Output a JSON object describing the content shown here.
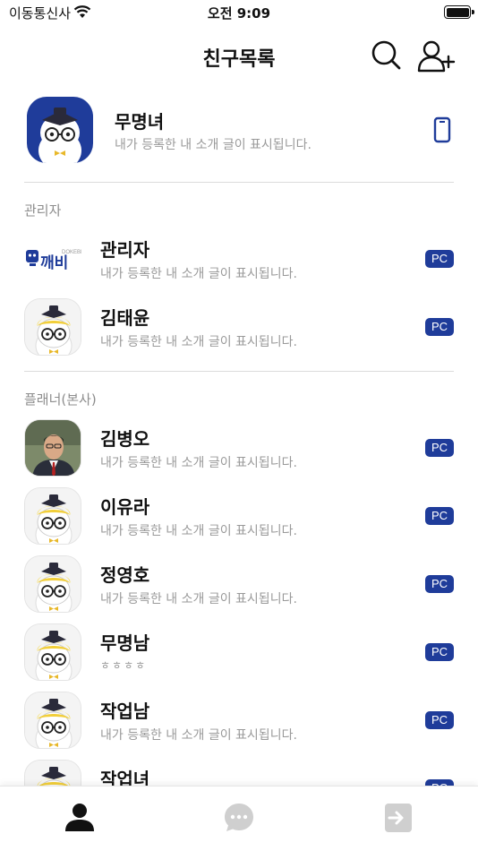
{
  "status": {
    "carrier": "이동통신사",
    "time": "오전 9:09"
  },
  "header": {
    "title": "친구목록"
  },
  "me": {
    "name": "무명녀",
    "intro": "내가 등록한 내 소개 글이 표시됩니다."
  },
  "sections": [
    {
      "title": "관리자",
      "friends": [
        {
          "name": "관리자",
          "intro": "내가 등록한 내 소개 글이 표시됩니다.",
          "badge": "PC",
          "avatar": "logo",
          "logo_text": "깨비",
          "logo_small": "DOKEBI"
        },
        {
          "name": "김태윤",
          "intro": "내가 등록한 내 소개 글이 표시됩니다.",
          "badge": "PC",
          "avatar": "mascot"
        }
      ]
    },
    {
      "title": "플래너(본사)",
      "friends": [
        {
          "name": "김병오",
          "intro": "내가 등록한 내 소개 글이 표시됩니다.",
          "badge": "PC",
          "avatar": "photo"
        },
        {
          "name": "이유라",
          "intro": "내가 등록한 내 소개 글이 표시됩니다.",
          "badge": "PC",
          "avatar": "mascot"
        },
        {
          "name": "정영호",
          "intro": "내가 등록한 내 소개 글이 표시됩니다.",
          "badge": "PC",
          "avatar": "mascot"
        },
        {
          "name": "무명남",
          "intro": "ㅎㅎㅎㅎ",
          "badge": "PC",
          "avatar": "mascot"
        },
        {
          "name": "작업남",
          "intro": "내가 등록한 내 소개 글이 표시됩니다.",
          "badge": "PC",
          "avatar": "mascot"
        },
        {
          "name": "작업녀",
          "intro": "",
          "badge": "PC",
          "avatar": "mascot"
        }
      ]
    }
  ],
  "tabs": [
    {
      "icon": "person-icon",
      "active": true
    },
    {
      "icon": "chat-bubble-icon",
      "active": false
    },
    {
      "icon": "logout-icon",
      "active": false
    }
  ],
  "colors": {
    "accent": "#1f3c9a",
    "inactive_tab": "#cfcfcf",
    "subtext": "#9a9a9a"
  }
}
